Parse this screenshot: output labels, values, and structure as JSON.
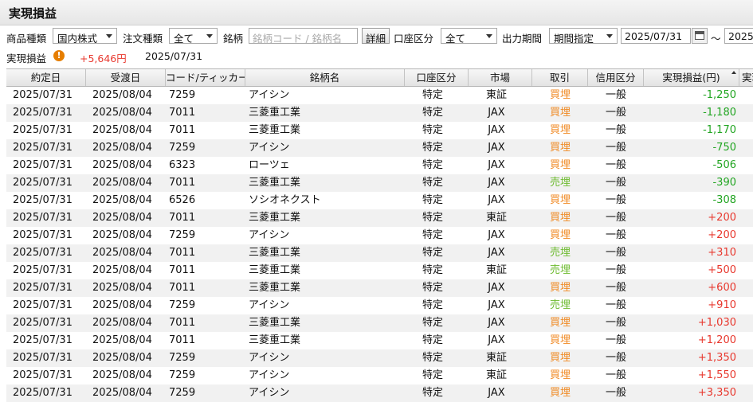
{
  "header": {
    "title": "実現損益"
  },
  "filters": {
    "product_type_label": "商品種類",
    "product_type_value": "国内株式",
    "order_type_label": "注文種類",
    "order_type_value": "全て",
    "symbol_label": "銘柄",
    "symbol_placeholder": "銘柄コード / 銘柄名",
    "detail_button": "詳細",
    "account_label": "口座区分",
    "account_value": "全て",
    "period_label": "出力期間",
    "period_value": "期間指定",
    "date_from": "2025/07/31",
    "range_sep": "～",
    "date_to": "2025/"
  },
  "summary": {
    "label": "実現損益",
    "warn_icon": "!",
    "amount": "+5,646円",
    "date": "2025/07/31"
  },
  "table": {
    "columns": [
      "約定日",
      "受渡日",
      "コード/ティッカー",
      "銘柄名",
      "口座区分",
      "市場",
      "取引",
      "信用区分",
      "実現損益(円)",
      "実現"
    ],
    "rows": [
      {
        "trade_date": "2025/07/31",
        "settle_date": "2025/08/04",
        "code": "7259",
        "name": "アイシン",
        "account": "特定",
        "market": "東証",
        "trade": "買埋",
        "credit": "一般",
        "pl": "-1,250"
      },
      {
        "trade_date": "2025/07/31",
        "settle_date": "2025/08/04",
        "code": "7011",
        "name": "三菱重工業",
        "account": "特定",
        "market": "JAX",
        "trade": "買埋",
        "credit": "一般",
        "pl": "-1,180"
      },
      {
        "trade_date": "2025/07/31",
        "settle_date": "2025/08/04",
        "code": "7011",
        "name": "三菱重工業",
        "account": "特定",
        "market": "JAX",
        "trade": "買埋",
        "credit": "一般",
        "pl": "-1,170"
      },
      {
        "trade_date": "2025/07/31",
        "settle_date": "2025/08/04",
        "code": "7259",
        "name": "アイシン",
        "account": "特定",
        "market": "JAX",
        "trade": "買埋",
        "credit": "一般",
        "pl": "-750"
      },
      {
        "trade_date": "2025/07/31",
        "settle_date": "2025/08/04",
        "code": "6323",
        "name": "ローツェ",
        "account": "特定",
        "market": "JAX",
        "trade": "買埋",
        "credit": "一般",
        "pl": "-506"
      },
      {
        "trade_date": "2025/07/31",
        "settle_date": "2025/08/04",
        "code": "7011",
        "name": "三菱重工業",
        "account": "特定",
        "market": "JAX",
        "trade": "売埋",
        "credit": "一般",
        "pl": "-390"
      },
      {
        "trade_date": "2025/07/31",
        "settle_date": "2025/08/04",
        "code": "6526",
        "name": "ソシオネクスト",
        "account": "特定",
        "market": "JAX",
        "trade": "買埋",
        "credit": "一般",
        "pl": "-308"
      },
      {
        "trade_date": "2025/07/31",
        "settle_date": "2025/08/04",
        "code": "7011",
        "name": "三菱重工業",
        "account": "特定",
        "market": "東証",
        "trade": "買埋",
        "credit": "一般",
        "pl": "+200"
      },
      {
        "trade_date": "2025/07/31",
        "settle_date": "2025/08/04",
        "code": "7259",
        "name": "アイシン",
        "account": "特定",
        "market": "JAX",
        "trade": "買埋",
        "credit": "一般",
        "pl": "+200"
      },
      {
        "trade_date": "2025/07/31",
        "settle_date": "2025/08/04",
        "code": "7011",
        "name": "三菱重工業",
        "account": "特定",
        "market": "JAX",
        "trade": "売埋",
        "credit": "一般",
        "pl": "+310"
      },
      {
        "trade_date": "2025/07/31",
        "settle_date": "2025/08/04",
        "code": "7011",
        "name": "三菱重工業",
        "account": "特定",
        "market": "東証",
        "trade": "売埋",
        "credit": "一般",
        "pl": "+500"
      },
      {
        "trade_date": "2025/07/31",
        "settle_date": "2025/08/04",
        "code": "7011",
        "name": "三菱重工業",
        "account": "特定",
        "market": "JAX",
        "trade": "買埋",
        "credit": "一般",
        "pl": "+600"
      },
      {
        "trade_date": "2025/07/31",
        "settle_date": "2025/08/04",
        "code": "7259",
        "name": "アイシン",
        "account": "特定",
        "market": "JAX",
        "trade": "売埋",
        "credit": "一般",
        "pl": "+910"
      },
      {
        "trade_date": "2025/07/31",
        "settle_date": "2025/08/04",
        "code": "7011",
        "name": "三菱重工業",
        "account": "特定",
        "market": "JAX",
        "trade": "買埋",
        "credit": "一般",
        "pl": "+1,030"
      },
      {
        "trade_date": "2025/07/31",
        "settle_date": "2025/08/04",
        "code": "7011",
        "name": "三菱重工業",
        "account": "特定",
        "market": "JAX",
        "trade": "買埋",
        "credit": "一般",
        "pl": "+1,200"
      },
      {
        "trade_date": "2025/07/31",
        "settle_date": "2025/08/04",
        "code": "7259",
        "name": "アイシン",
        "account": "特定",
        "market": "東証",
        "trade": "買埋",
        "credit": "一般",
        "pl": "+1,350"
      },
      {
        "trade_date": "2025/07/31",
        "settle_date": "2025/08/04",
        "code": "7259",
        "name": "アイシン",
        "account": "特定",
        "market": "東証",
        "trade": "買埋",
        "credit": "一般",
        "pl": "+1,550"
      },
      {
        "trade_date": "2025/07/31",
        "settle_date": "2025/08/04",
        "code": "7259",
        "name": "アイシン",
        "account": "特定",
        "market": "JAX",
        "trade": "買埋",
        "credit": "一般",
        "pl": "+3,350"
      }
    ]
  },
  "colors": {
    "buy": "#f08a24",
    "sell": "#6dbb2f",
    "loss": "#22a522",
    "profit": "#e8382e",
    "warn": "#e67e00"
  }
}
